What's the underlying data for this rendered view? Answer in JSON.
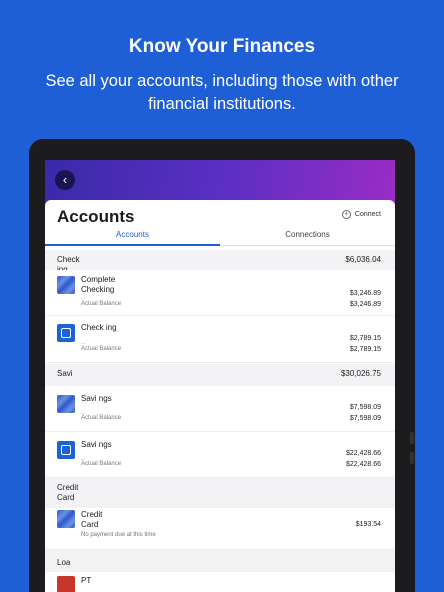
{
  "promo": {
    "headline": "Know Your Finances",
    "subline": "See all your accounts, including those with other financial institutions."
  },
  "header": {
    "title": "Accounts",
    "connect_label": "Connect",
    "tabs": [
      "Accounts",
      "Connections"
    ]
  },
  "sections": [
    {
      "name": "Check ing",
      "total": "$6,036.04"
    },
    {
      "name": "Savi",
      "total": "$30,026.75"
    },
    {
      "name": "Credit Card",
      "total": ""
    },
    {
      "name": "Loa",
      "total": ""
    }
  ],
  "accounts": [
    {
      "name": "Complete Checking",
      "sub": "...",
      "balance_label": "Actual Balance",
      "value1": "$3,246.89",
      "value2": "$3,246.89"
    },
    {
      "name": "Check ing",
      "sub": "...",
      "balance_label": "Actual Balance",
      "value1": "$2,789.15",
      "value2": "$2,789.15"
    },
    {
      "name": "Savi ngs",
      "sub": "...",
      "balance_label": "Actual Balance",
      "value1": "$7,598.09",
      "value2": "$7,598.09"
    },
    {
      "name": "Savi ngs",
      "sub": "...",
      "balance_label": "Actual Balance",
      "value1": "$22,428.66",
      "value2": "$22,428.66"
    },
    {
      "name": "Credit Card",
      "sub": "...",
      "balance_label": "No payment due at this time",
      "value1": "$193.54",
      "value2": ""
    },
    {
      "name": "PT",
      "sub": "",
      "balance_label": "",
      "value1": "",
      "value2": ""
    }
  ],
  "colors": {
    "background": "#1f5fd6",
    "accent": "#1f5fd6",
    "banner_start": "#3a2aa8",
    "banner_end": "#9a2cc6"
  },
  "icons": {
    "back": "chevron-left-icon",
    "connect": "plus-circle-icon"
  }
}
